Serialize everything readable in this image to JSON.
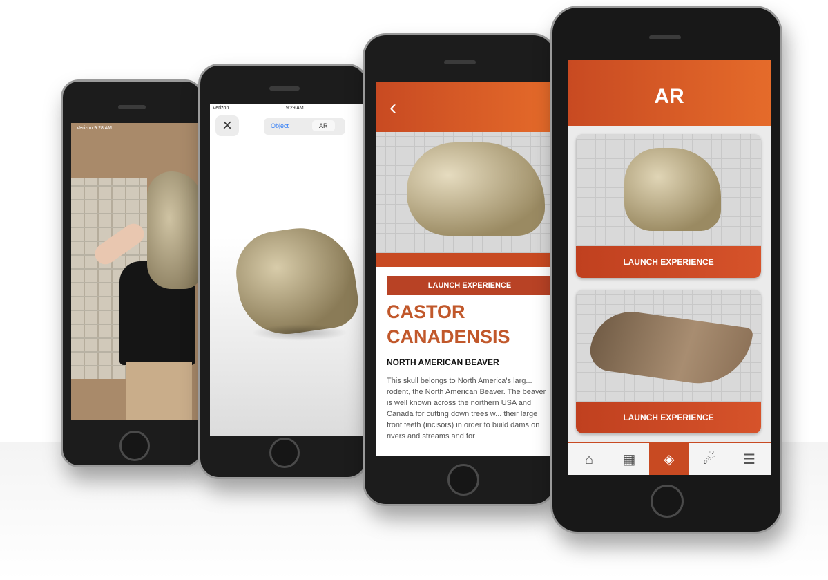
{
  "phone1": {
    "status_bar": "Verizon 9:28 AM"
  },
  "phone2": {
    "status_carrier": "Verizon",
    "status_time": "9:29 AM",
    "close_icon": "close-icon",
    "segment_object": "Object",
    "segment_ar": "AR"
  },
  "phone3": {
    "back_icon": "chevron-left-icon",
    "launch_label": "LAUNCH EXPERIENCE",
    "title_line1": "CASTOR",
    "title_line2": "CANADENSIS",
    "subtitle": "NORTH AMERICAN BEAVER",
    "body": "This skull belongs to North America's larg... rodent, the North American Beaver. The beaver is well known across the northern USA and Canada for cutting down trees w... their large front teeth (incisors) in order to build dams on rivers and streams and for"
  },
  "phone4": {
    "header_title": "AR",
    "cards": [
      {
        "button_label": "LAUNCH EXPERIENCE"
      },
      {
        "button_label": "LAUNCH EXPERIENCE"
      }
    ],
    "tabbar": [
      {
        "icon": "home-icon",
        "glyph": "⌂"
      },
      {
        "icon": "calendar-icon",
        "glyph": "▦"
      },
      {
        "icon": "ar-icon",
        "glyph": "◈"
      },
      {
        "icon": "fossil-icon",
        "glyph": "☄"
      },
      {
        "icon": "menu-icon",
        "glyph": "☰"
      }
    ],
    "accent_color": "#c84a22"
  }
}
